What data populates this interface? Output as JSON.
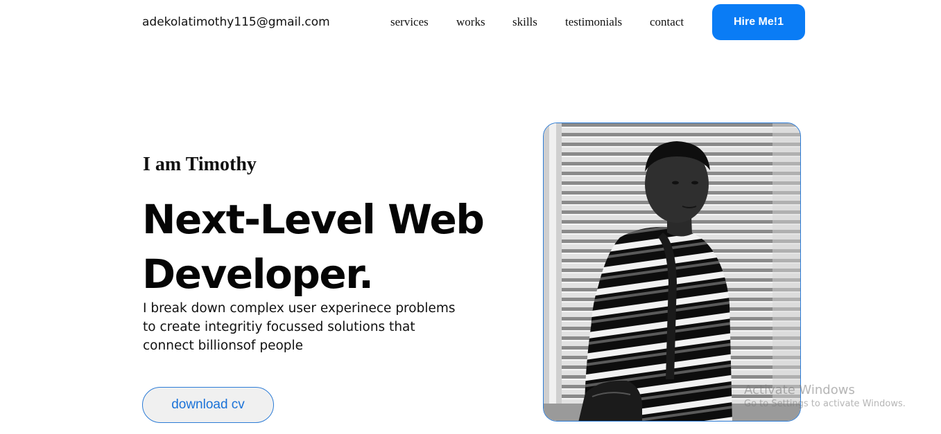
{
  "header": {
    "email": "adekolatimothy115@gmail.com",
    "nav": {
      "services": "services",
      "works": "works",
      "skills": "skills",
      "testimonials": "testimonials",
      "contact": "contact"
    },
    "hire_label": "Hire Me!1"
  },
  "hero": {
    "intro": "I am Timothy",
    "headline_line1": "Next-Level Web",
    "headline_line2": "Developer.",
    "description": "I break down complex user experinece problems to create integritiy focussed solutions that connect billionsof people",
    "cv_label": "download cv",
    "photo_icon": "portrait-photo"
  },
  "watermark": {
    "title": "Activate Windows",
    "subtitle": "Go to Settings to activate Windows."
  },
  "colors": {
    "accent": "#0a7cf5",
    "border_blue": "#2b7bd6",
    "text": "#111111"
  }
}
